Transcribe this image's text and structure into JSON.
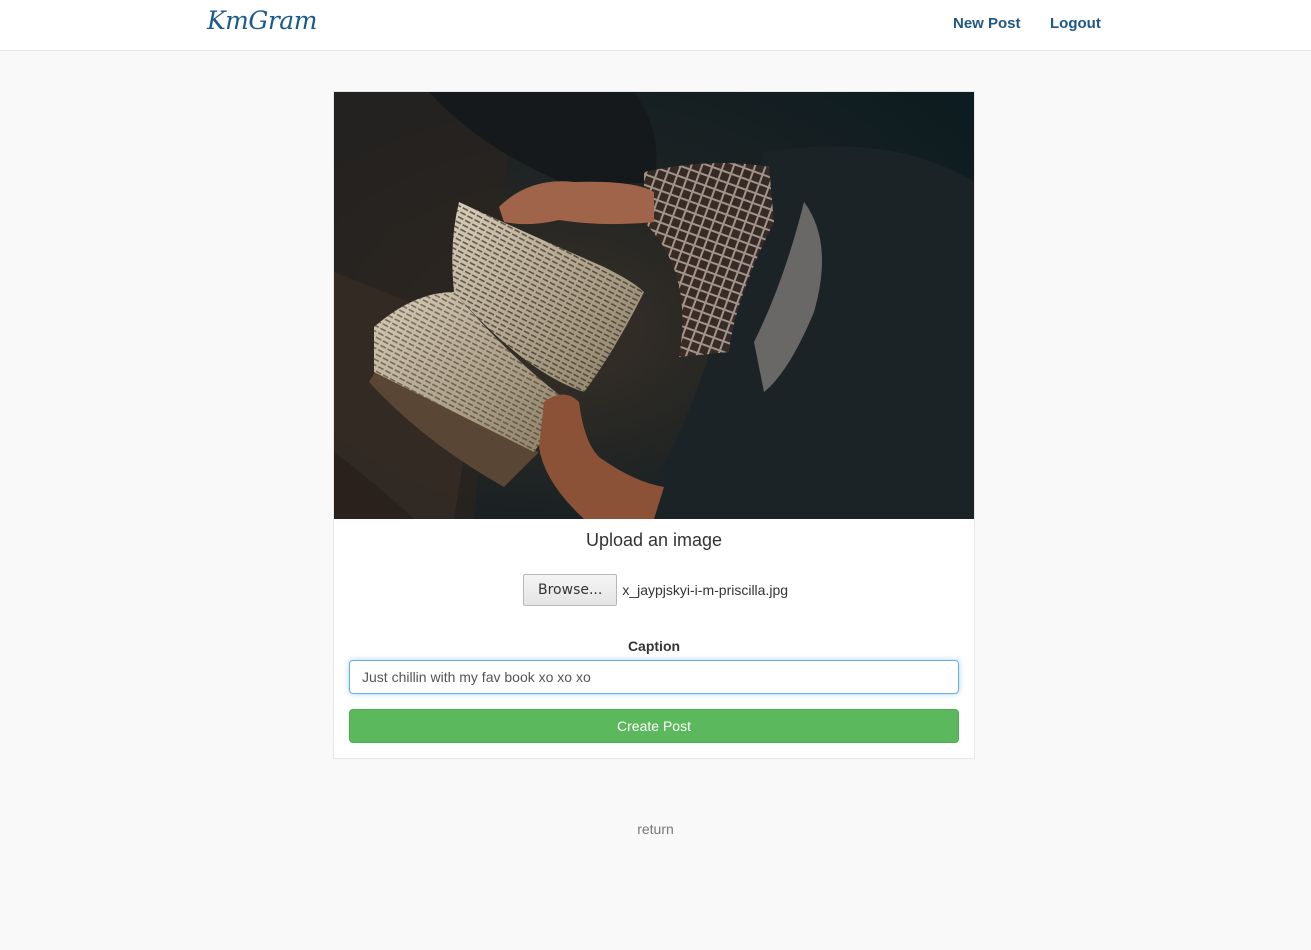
{
  "navbar": {
    "brand": "KmGram",
    "new_post": "New Post",
    "logout": "Logout"
  },
  "upload": {
    "image_icon": "photo-of-person-reading-book",
    "title": "Upload an image",
    "browse_label": "Browse...",
    "file_name": "x_jaypjskyi-i-m-priscilla.jpg",
    "caption_label": "Caption",
    "caption_value": "Just chillin with my fav book xo xo xo",
    "submit_label": "Create Post"
  },
  "footer": {
    "return": "return"
  },
  "colors": {
    "brand": "#1a5a8c",
    "primary_button": "#5cb85c",
    "focus_border": "#66afe9"
  }
}
